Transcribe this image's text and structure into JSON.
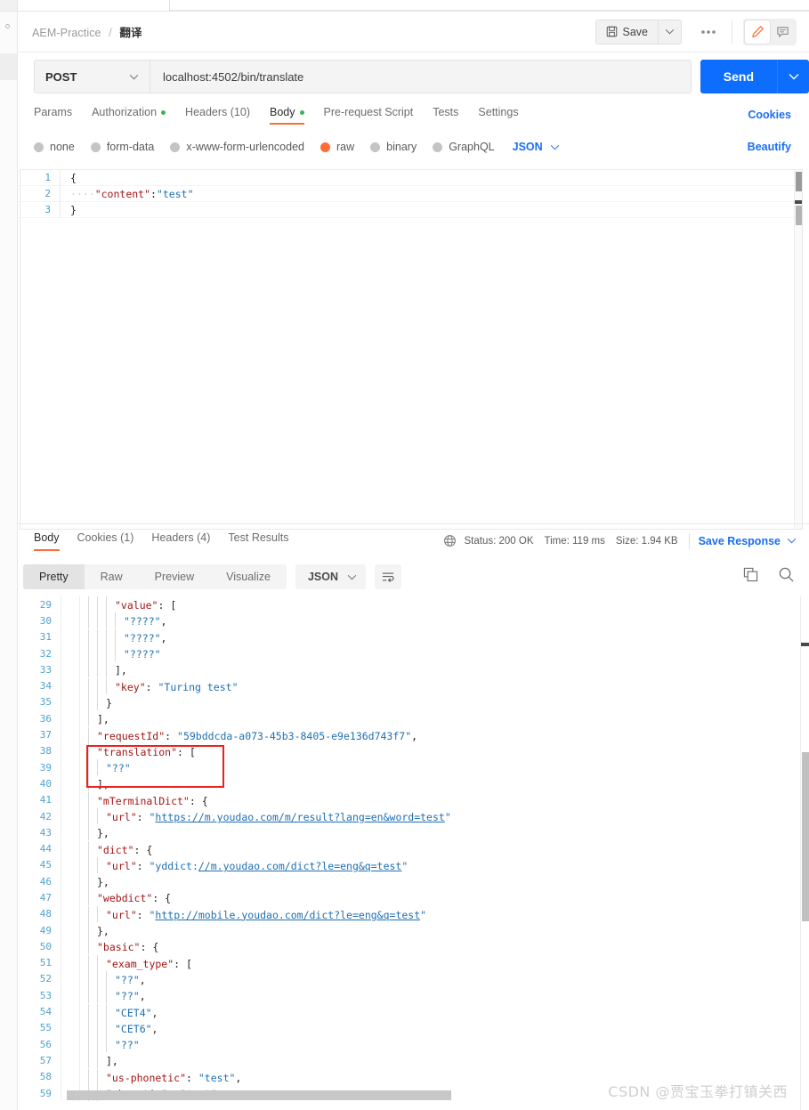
{
  "breadcrumb": {
    "collection": "AEM-Practice",
    "separator": "/",
    "current": "翻译"
  },
  "toolbar": {
    "save_label": "Save",
    "save_icon": "floppy-disk-icon",
    "save_caret_icon": "chevron-down-icon",
    "more_label": "●●●",
    "edit_icon": "pencil-icon",
    "comment_icon": "comment-icon"
  },
  "request": {
    "method": "POST",
    "method_caret_icon": "chevron-down-icon",
    "url": "localhost:4502/bin/translate",
    "send_label": "Send",
    "send_caret_icon": "chevron-down-icon",
    "tabs": [
      {
        "label": "Params",
        "dot": false,
        "active": false
      },
      {
        "label": "Authorization",
        "dot": true,
        "active": false
      },
      {
        "label": "Headers (10)",
        "dot": false,
        "active": false
      },
      {
        "label": "Body",
        "dot": true,
        "active": true
      },
      {
        "label": "Pre-request Script",
        "dot": false,
        "active": false
      },
      {
        "label": "Tests",
        "dot": false,
        "active": false
      },
      {
        "label": "Settings",
        "dot": false,
        "active": false
      }
    ],
    "cookies_link": "Cookies",
    "beautify_link": "Beautify",
    "body_types": [
      {
        "label": "none",
        "selected": false
      },
      {
        "label": "form-data",
        "selected": false
      },
      {
        "label": "x-www-form-urlencoded",
        "selected": false
      },
      {
        "label": "raw",
        "selected": true
      },
      {
        "label": "binary",
        "selected": false
      },
      {
        "label": "GraphQL",
        "selected": false
      }
    ],
    "format": "JSON",
    "format_caret_icon": "chevron-down-icon",
    "body_lines": [
      {
        "n": "1",
        "text": "{"
      },
      {
        "n": "2",
        "text": "····\"content\":\"test\""
      },
      {
        "n": "3",
        "text": "}"
      }
    ]
  },
  "response": {
    "tabs": [
      {
        "label": "Body",
        "active": true
      },
      {
        "label": "Cookies (1)",
        "active": false
      },
      {
        "label": "Headers (4)",
        "active": false
      },
      {
        "label": "Test Results",
        "active": false
      }
    ],
    "globe_icon": "globe-icon",
    "status": "Status: 200 OK",
    "time": "Time: 119 ms",
    "size": "Size: 1.94 KB",
    "save_response": "Save Response",
    "save_response_caret_icon": "chevron-down-icon",
    "view_modes": [
      {
        "label": "Pretty",
        "active": true
      },
      {
        "label": "Raw",
        "active": false
      },
      {
        "label": "Preview",
        "active": false
      },
      {
        "label": "Visualize",
        "active": false
      }
    ],
    "format": "JSON",
    "format_caret_icon": "chevron-down-icon",
    "wrap_icon": "word-wrap-icon",
    "copy_icon": "copy-icon",
    "search_icon": "search-icon",
    "body_lines": [
      {
        "n": "29",
        "indent": 3,
        "parts": [
          {
            "t": "\"value\"",
            "c": "p"
          },
          {
            "t": ": ",
            "c": "b"
          },
          {
            "t": "[",
            "c": "b"
          }
        ]
      },
      {
        "n": "30",
        "indent": 4,
        "parts": [
          {
            "t": "\"????\"",
            "c": "s"
          },
          {
            "t": ",",
            "c": "b"
          }
        ]
      },
      {
        "n": "31",
        "indent": 4,
        "parts": [
          {
            "t": "\"????\"",
            "c": "s"
          },
          {
            "t": ",",
            "c": "b"
          }
        ]
      },
      {
        "n": "32",
        "indent": 4,
        "parts": [
          {
            "t": "\"????\"",
            "c": "s"
          }
        ]
      },
      {
        "n": "33",
        "indent": 3,
        "parts": [
          {
            "t": "],",
            "c": "b"
          }
        ]
      },
      {
        "n": "34",
        "indent": 3,
        "parts": [
          {
            "t": "\"key\"",
            "c": "p"
          },
          {
            "t": ": ",
            "c": "b"
          },
          {
            "t": "\"Turing test\"",
            "c": "s"
          }
        ]
      },
      {
        "n": "35",
        "indent": 2,
        "parts": [
          {
            "t": "}",
            "c": "b"
          }
        ]
      },
      {
        "n": "36",
        "indent": 1,
        "parts": [
          {
            "t": "],",
            "c": "b"
          }
        ]
      },
      {
        "n": "37",
        "indent": 1,
        "parts": [
          {
            "t": "\"requestId\"",
            "c": "p"
          },
          {
            "t": ": ",
            "c": "b"
          },
          {
            "t": "\"59bddcda-a073-45b3-8405-e9e136d743f7\"",
            "c": "s"
          },
          {
            "t": ",",
            "c": "b"
          }
        ]
      },
      {
        "n": "38",
        "indent": 1,
        "parts": [
          {
            "t": "\"translation\"",
            "c": "p"
          },
          {
            "t": ": ",
            "c": "b"
          },
          {
            "t": "[",
            "c": "b"
          }
        ]
      },
      {
        "n": "39",
        "indent": 2,
        "parts": [
          {
            "t": "\"??\"",
            "c": "s"
          }
        ]
      },
      {
        "n": "40",
        "indent": 1,
        "parts": [
          {
            "t": "],",
            "c": "b"
          }
        ]
      },
      {
        "n": "41",
        "indent": 1,
        "parts": [
          {
            "t": "\"mTerminalDict\"",
            "c": "p"
          },
          {
            "t": ": ",
            "c": "b"
          },
          {
            "t": "{",
            "c": "b"
          }
        ]
      },
      {
        "n": "42",
        "indent": 2,
        "parts": [
          {
            "t": "\"url\"",
            "c": "p"
          },
          {
            "t": ": ",
            "c": "b"
          },
          {
            "t": "\"",
            "c": "s"
          },
          {
            "t": "https://m.youdao.com/m/result?lang=en&word=test",
            "c": "link"
          },
          {
            "t": "\"",
            "c": "s"
          }
        ]
      },
      {
        "n": "43",
        "indent": 1,
        "parts": [
          {
            "t": "},",
            "c": "b"
          }
        ]
      },
      {
        "n": "44",
        "indent": 1,
        "parts": [
          {
            "t": "\"dict\"",
            "c": "p"
          },
          {
            "t": ": ",
            "c": "b"
          },
          {
            "t": "{",
            "c": "b"
          }
        ]
      },
      {
        "n": "45",
        "indent": 2,
        "parts": [
          {
            "t": "\"url\"",
            "c": "p"
          },
          {
            "t": ": ",
            "c": "b"
          },
          {
            "t": "\"yddict:",
            "c": "s"
          },
          {
            "t": "//m.youdao.com/dict?le=eng&q=test",
            "c": "link"
          },
          {
            "t": "\"",
            "c": "s"
          }
        ]
      },
      {
        "n": "46",
        "indent": 1,
        "parts": [
          {
            "t": "},",
            "c": "b"
          }
        ]
      },
      {
        "n": "47",
        "indent": 1,
        "parts": [
          {
            "t": "\"webdict\"",
            "c": "p"
          },
          {
            "t": ": ",
            "c": "b"
          },
          {
            "t": "{",
            "c": "b"
          }
        ]
      },
      {
        "n": "48",
        "indent": 2,
        "parts": [
          {
            "t": "\"url\"",
            "c": "p"
          },
          {
            "t": ": ",
            "c": "b"
          },
          {
            "t": "\"",
            "c": "s"
          },
          {
            "t": "http://mobile.youdao.com/dict?le=eng&q=test",
            "c": "link"
          },
          {
            "t": "\"",
            "c": "s"
          }
        ]
      },
      {
        "n": "49",
        "indent": 1,
        "parts": [
          {
            "t": "},",
            "c": "b"
          }
        ]
      },
      {
        "n": "50",
        "indent": 1,
        "parts": [
          {
            "t": "\"basic\"",
            "c": "p"
          },
          {
            "t": ": ",
            "c": "b"
          },
          {
            "t": "{",
            "c": "b"
          }
        ]
      },
      {
        "n": "51",
        "indent": 2,
        "parts": [
          {
            "t": "\"exam_type\"",
            "c": "p"
          },
          {
            "t": ": ",
            "c": "b"
          },
          {
            "t": "[",
            "c": "b"
          }
        ]
      },
      {
        "n": "52",
        "indent": 3,
        "parts": [
          {
            "t": "\"??\"",
            "c": "s"
          },
          {
            "t": ",",
            "c": "b"
          }
        ]
      },
      {
        "n": "53",
        "indent": 3,
        "parts": [
          {
            "t": "\"??\"",
            "c": "s"
          },
          {
            "t": ",",
            "c": "b"
          }
        ]
      },
      {
        "n": "54",
        "indent": 3,
        "parts": [
          {
            "t": "\"CET4\"",
            "c": "s"
          },
          {
            "t": ",",
            "c": "b"
          }
        ]
      },
      {
        "n": "55",
        "indent": 3,
        "parts": [
          {
            "t": "\"CET6\"",
            "c": "s"
          },
          {
            "t": ",",
            "c": "b"
          }
        ]
      },
      {
        "n": "56",
        "indent": 3,
        "parts": [
          {
            "t": "\"??\"",
            "c": "s"
          }
        ]
      },
      {
        "n": "57",
        "indent": 2,
        "parts": [
          {
            "t": "],",
            "c": "b"
          }
        ]
      },
      {
        "n": "58",
        "indent": 2,
        "parts": [
          {
            "t": "\"us-phonetic\"",
            "c": "p"
          },
          {
            "t": ": ",
            "c": "b"
          },
          {
            "t": "\"test\"",
            "c": "s"
          },
          {
            "t": ",",
            "c": "b"
          }
        ]
      },
      {
        "n": "59",
        "indent": 2,
        "parts": [
          {
            "t": "\"phonetic\"",
            "c": "p"
          },
          {
            "t": ": ",
            "c": "b"
          },
          {
            "t": "\"test\"",
            "c": "s"
          },
          {
            "t": ",",
            "c": "b"
          }
        ]
      }
    ],
    "annotation_box": "translation-highlight"
  },
  "watermark": "CSDN @贾宝玉拳打镇关西"
}
